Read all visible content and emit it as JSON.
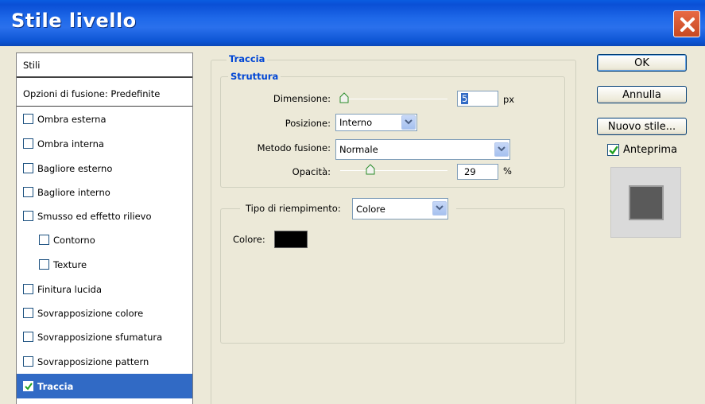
{
  "window": {
    "title": "Stile livello"
  },
  "styles_list": {
    "header": "Stili",
    "blending": "Opzioni di fusione: Predefinite",
    "items": [
      {
        "label": "Ombra esterna",
        "checked": false
      },
      {
        "label": "Ombra interna",
        "checked": false
      },
      {
        "label": "Bagliore esterno",
        "checked": false
      },
      {
        "label": "Bagliore interno",
        "checked": false
      },
      {
        "label": "Smusso ed effetto rilievo",
        "checked": false
      },
      {
        "label": "Contorno",
        "checked": false
      },
      {
        "label": "Texture",
        "checked": false
      },
      {
        "label": "Finitura lucida",
        "checked": false
      },
      {
        "label": "Sovrapposizione colore",
        "checked": false
      },
      {
        "label": "Sovrapposizione sfumatura",
        "checked": false
      },
      {
        "label": "Sovrapposizione pattern",
        "checked": false
      },
      {
        "label": "Traccia",
        "checked": true,
        "selected": true
      }
    ]
  },
  "stroke": {
    "section_title": "Traccia",
    "structure_title": "Struttura",
    "size_label": "Dimensione:",
    "size_value": "5",
    "size_unit": "px",
    "position_label": "Posizione:",
    "position_value": "Interno",
    "blend_label": "Metodo fusione:",
    "blend_value": "Normale",
    "opacity_label": "Opacità:",
    "opacity_value": "29",
    "opacity_unit": "%",
    "fill_type_label": "Tipo di riempimento:",
    "fill_type_value": "Colore",
    "color_label": "Colore:",
    "color_value": "#000000"
  },
  "buttons": {
    "ok": "OK",
    "cancel": "Annulla",
    "new_style": "Nuovo stile...",
    "preview_label": "Anteprima",
    "preview_checked": true
  },
  "colors": {
    "titlebar": "#0a4fd6",
    "selection": "#316ac5",
    "group_label": "#0046d5"
  }
}
